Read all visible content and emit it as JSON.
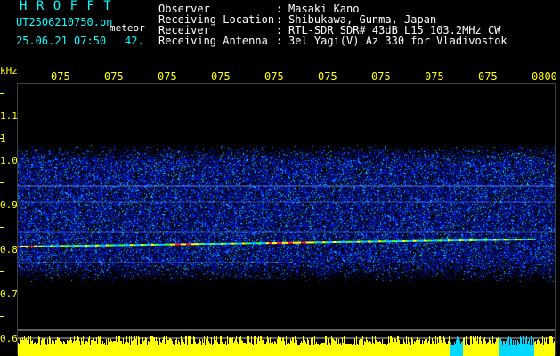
{
  "header": {
    "logo": "H R O F F T",
    "filename": "UT2506210750.pn",
    "mode": "meteor",
    "datetime": "25.06.21 07:50",
    "count": "42."
  },
  "station_info": [
    {
      "key": "Observer",
      "sep": ":",
      "value": "Masaki Kano"
    },
    {
      "key": "Receiving Location",
      "sep": ":",
      "value": "Shibukawa, Gunma, Japan"
    },
    {
      "key": "Receiver",
      "sep": ":",
      "value": "RTL-SDR SDR# 43dB L15 103.2MHz CW"
    },
    {
      "key": "Receiving Antenna",
      "sep": ":",
      "value": "3el Yagi(V) Az 330 for Vladivostok"
    }
  ],
  "axes": {
    "y_unit": "kHz",
    "x_ticks": [
      "075",
      "075",
      "075",
      "075",
      "075",
      "075",
      "075",
      "075",
      "075",
      "0800"
    ],
    "y_ticks": [
      "1.1",
      "1",
      "1.0",
      "0.9",
      "0.8",
      "0.7",
      "0.6"
    ]
  },
  "colors": {
    "label_yellow": "#ffff00",
    "info_white": "#ffffff",
    "logo_cyan": "#00ffff",
    "plot_blue": "#1e1eff",
    "echo_red": "#ff2020",
    "echo_green": "#40ff40",
    "histogram_yellow": "#ffff00",
    "histogram_cyan": "#00d8ff"
  }
}
